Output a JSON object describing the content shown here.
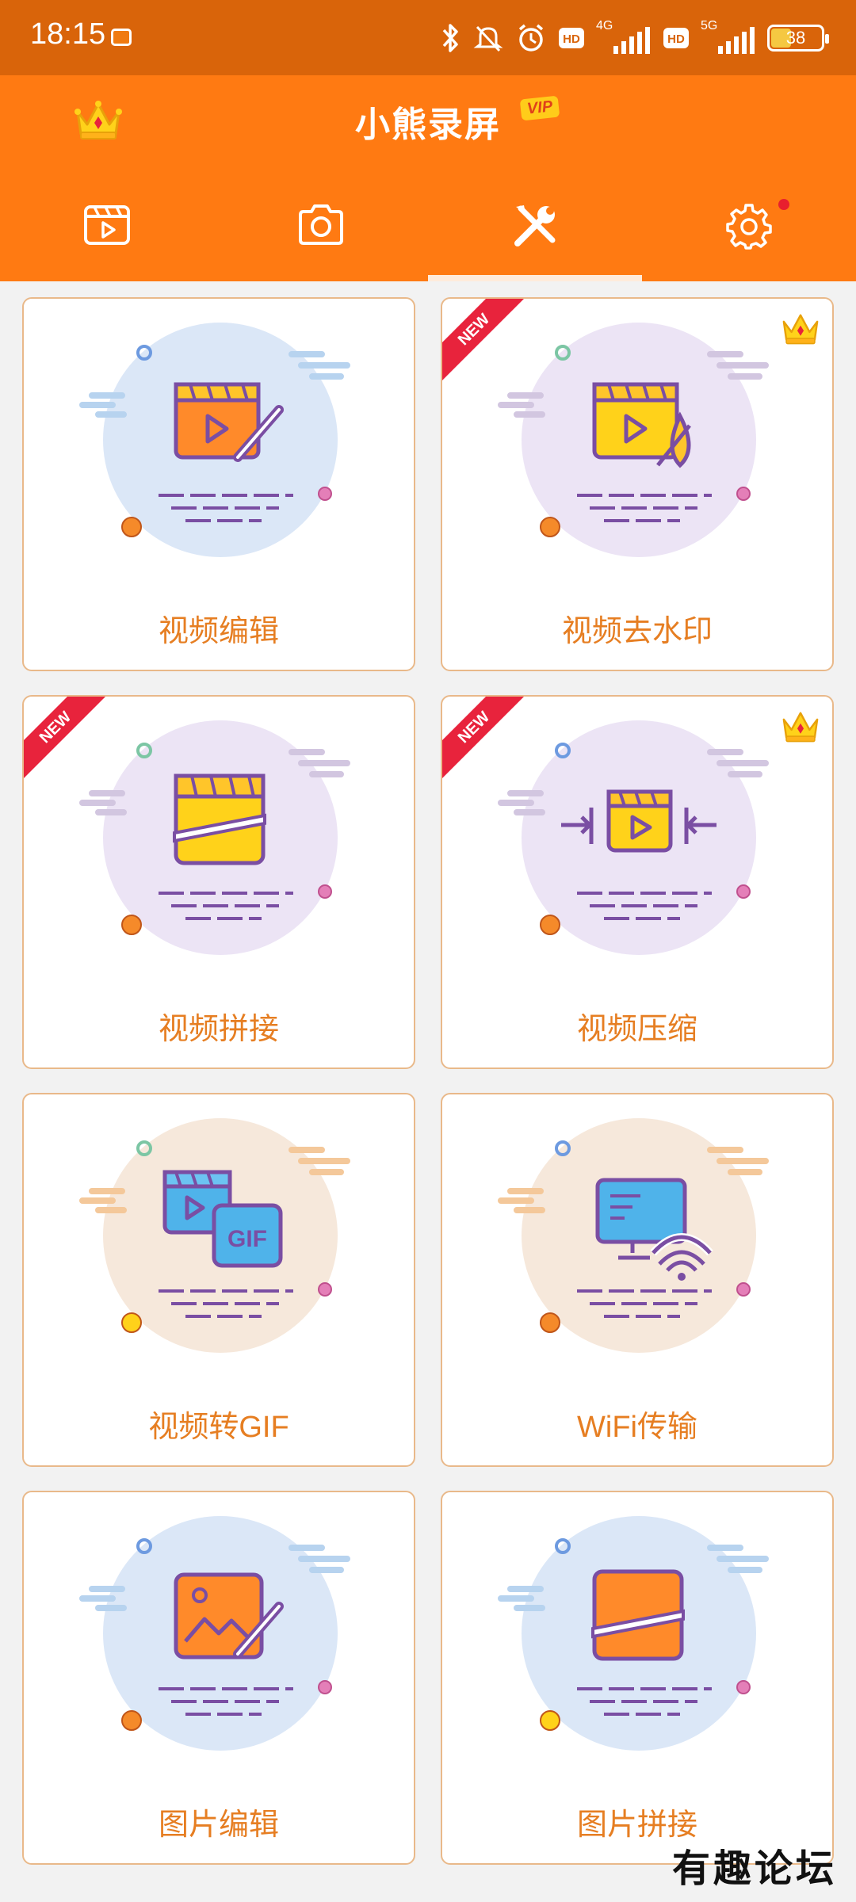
{
  "status_bar": {
    "time": "18:15",
    "net1": "4G",
    "net2": "5G",
    "hd": "HD",
    "battery": "38",
    "battery_level": 0.38
  },
  "header": {
    "title": "小熊录屏",
    "vip": "VIP"
  },
  "tabs": [
    {
      "icon": "video-icon",
      "active": false
    },
    {
      "icon": "camera-icon",
      "active": false
    },
    {
      "icon": "tools-icon",
      "active": true
    },
    {
      "icon": "settings-icon",
      "active": false,
      "dot": true
    }
  ],
  "tools": [
    {
      "label": "视频编辑",
      "icon": "video-edit-icon",
      "new": false,
      "vip": false,
      "bg": "#dbe7f7"
    },
    {
      "label": "视频去水印",
      "icon": "video-watermark-remove-icon",
      "new": true,
      "vip": true,
      "bg": "#ece4f5"
    },
    {
      "label": "视频拼接",
      "icon": "video-merge-icon",
      "new": true,
      "vip": false,
      "bg": "#ece4f5"
    },
    {
      "label": "视频压缩",
      "icon": "video-compress-icon",
      "new": true,
      "vip": true,
      "bg": "#ece4f5"
    },
    {
      "label": "视频转GIF",
      "icon": "video-to-gif-icon",
      "new": false,
      "vip": false,
      "bg": "#f6e8db"
    },
    {
      "label": "WiFi传输",
      "icon": "wifi-transfer-icon",
      "new": false,
      "vip": false,
      "bg": "#f6e8db"
    },
    {
      "label": "图片编辑",
      "icon": "image-edit-icon",
      "new": false,
      "vip": false,
      "bg": "#dbe7f7"
    },
    {
      "label": "图片拼接",
      "icon": "image-merge-icon",
      "new": false,
      "vip": false,
      "bg": "#dbe7f7"
    }
  ],
  "badges": {
    "new": "NEW",
    "gif": "GIF"
  },
  "watermark": "有趣论坛",
  "colors": {
    "status_bar": "#d9640a",
    "header": "#ff7a12",
    "label": "#e67e22",
    "ribbon": "#e8233c"
  }
}
